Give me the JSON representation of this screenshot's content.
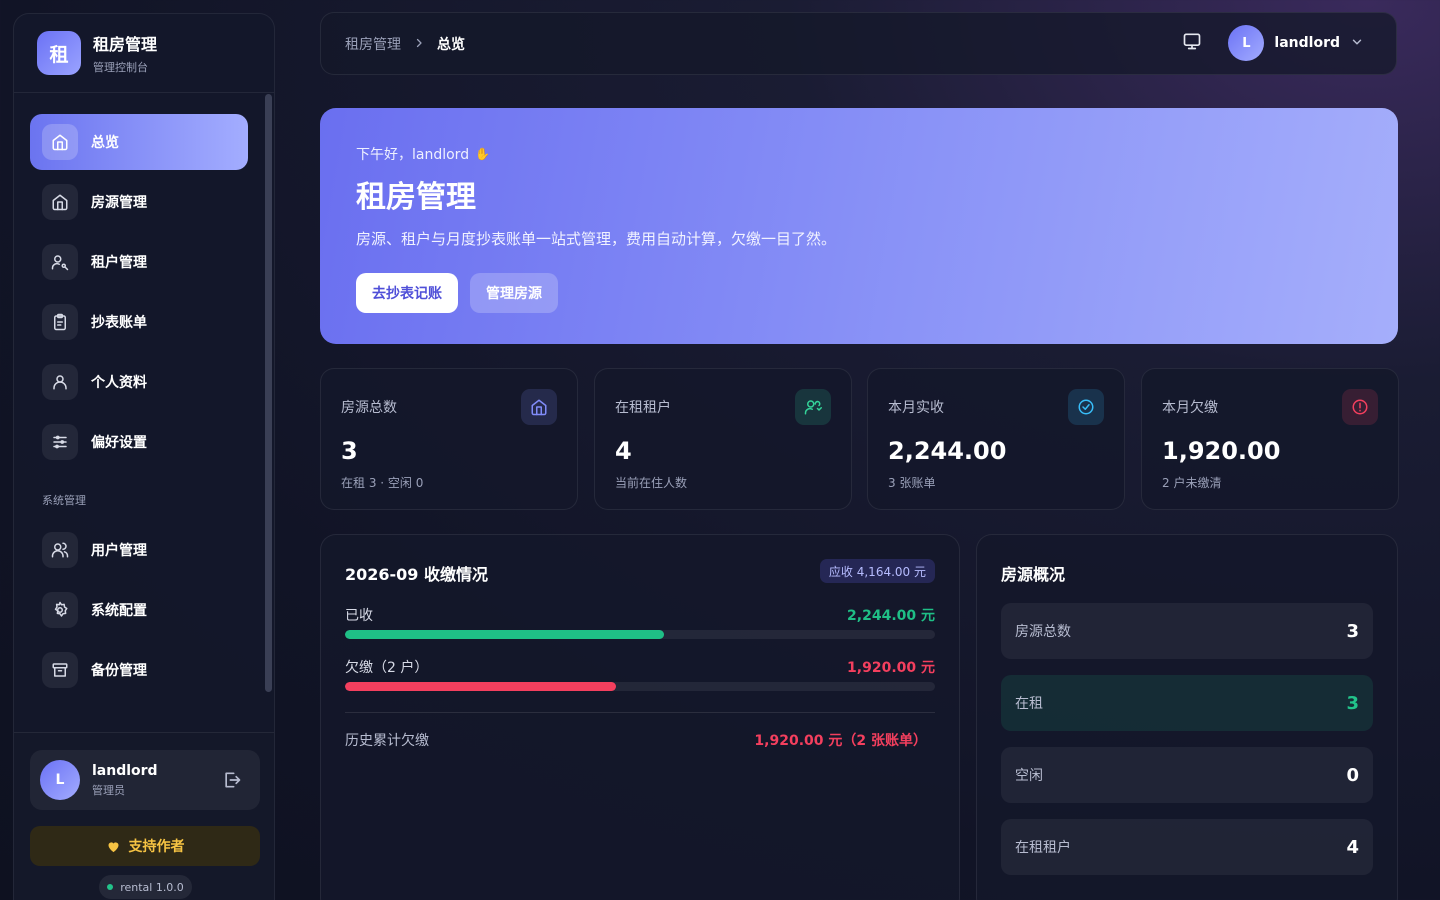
{
  "brand": {
    "logo_char": "租",
    "title": "租房管理",
    "subtitle": "管理控制台"
  },
  "sidebar": {
    "items": [
      {
        "label": "总览",
        "icon": "home-icon",
        "active": true
      },
      {
        "label": "房源管理",
        "icon": "house-icon",
        "active": false
      },
      {
        "label": "租户管理",
        "icon": "user-key-icon",
        "active": false
      },
      {
        "label": "抄表账单",
        "icon": "clipboard-icon",
        "active": false
      },
      {
        "label": "个人资料",
        "icon": "user-icon",
        "active": false
      },
      {
        "label": "偏好设置",
        "icon": "sliders-icon",
        "active": false
      }
    ],
    "section_label": "系统管理",
    "admin_items": [
      {
        "label": "用户管理",
        "icon": "users-icon"
      },
      {
        "label": "系统配置",
        "icon": "gear-icon"
      },
      {
        "label": "备份管理",
        "icon": "archive-icon"
      }
    ],
    "user": {
      "initial": "L",
      "name": "landlord",
      "role": "管理员"
    },
    "support_label": "支持作者",
    "version": "rental 1.0.0"
  },
  "topbar": {
    "breadcrumb": [
      "租房管理",
      "总览"
    ],
    "user_initial": "L",
    "user_name": "landlord"
  },
  "hero": {
    "greeting": "下午好，landlord",
    "title": "租房管理",
    "description": "房源、租户与月度抄表账单一站式管理，费用自动计算，欠缴一目了然。",
    "primary_button": "去抄表记账",
    "secondary_button": "管理房源"
  },
  "stats": [
    {
      "label": "房源总数",
      "value": "3",
      "sub": "在租 3 · 空闲 0",
      "icon": "house-icon",
      "color": "#818cf8"
    },
    {
      "label": "在租租户",
      "value": "4",
      "sub": "当前在住人数",
      "icon": "user-check-icon",
      "color": "#34d399"
    },
    {
      "label": "本月实收",
      "value": "2,244.00",
      "sub": "3 张账单",
      "icon": "check-circle-icon",
      "color": "#38bdf8"
    },
    {
      "label": "本月欠缴",
      "value": "1,920.00",
      "sub": "2 户未缴清",
      "icon": "alert-circle-icon",
      "color": "#f43f5e"
    }
  ],
  "payment": {
    "title": "2026-09 收缴情况",
    "due_badge": "应收 4,164.00 元",
    "paid_label": "已收",
    "paid_value": "2,244.00 元",
    "paid_ratio": 0.54,
    "unpaid_label": "欠缴（2 户）",
    "unpaid_value": "1,920.00 元",
    "unpaid_ratio": 0.46,
    "history_label": "历史累计欠缴",
    "history_value": "1,920.00 元（2 张账单）",
    "colors": {
      "paid": "#1fbf86",
      "unpaid": "#f43f5e"
    }
  },
  "overview": {
    "title": "房源概况",
    "rows": [
      {
        "label": "房源总数",
        "value": "3"
      },
      {
        "label": "在租",
        "value": "3"
      },
      {
        "label": "空闲",
        "value": "0"
      },
      {
        "label": "在租租户",
        "value": "4"
      }
    ]
  }
}
